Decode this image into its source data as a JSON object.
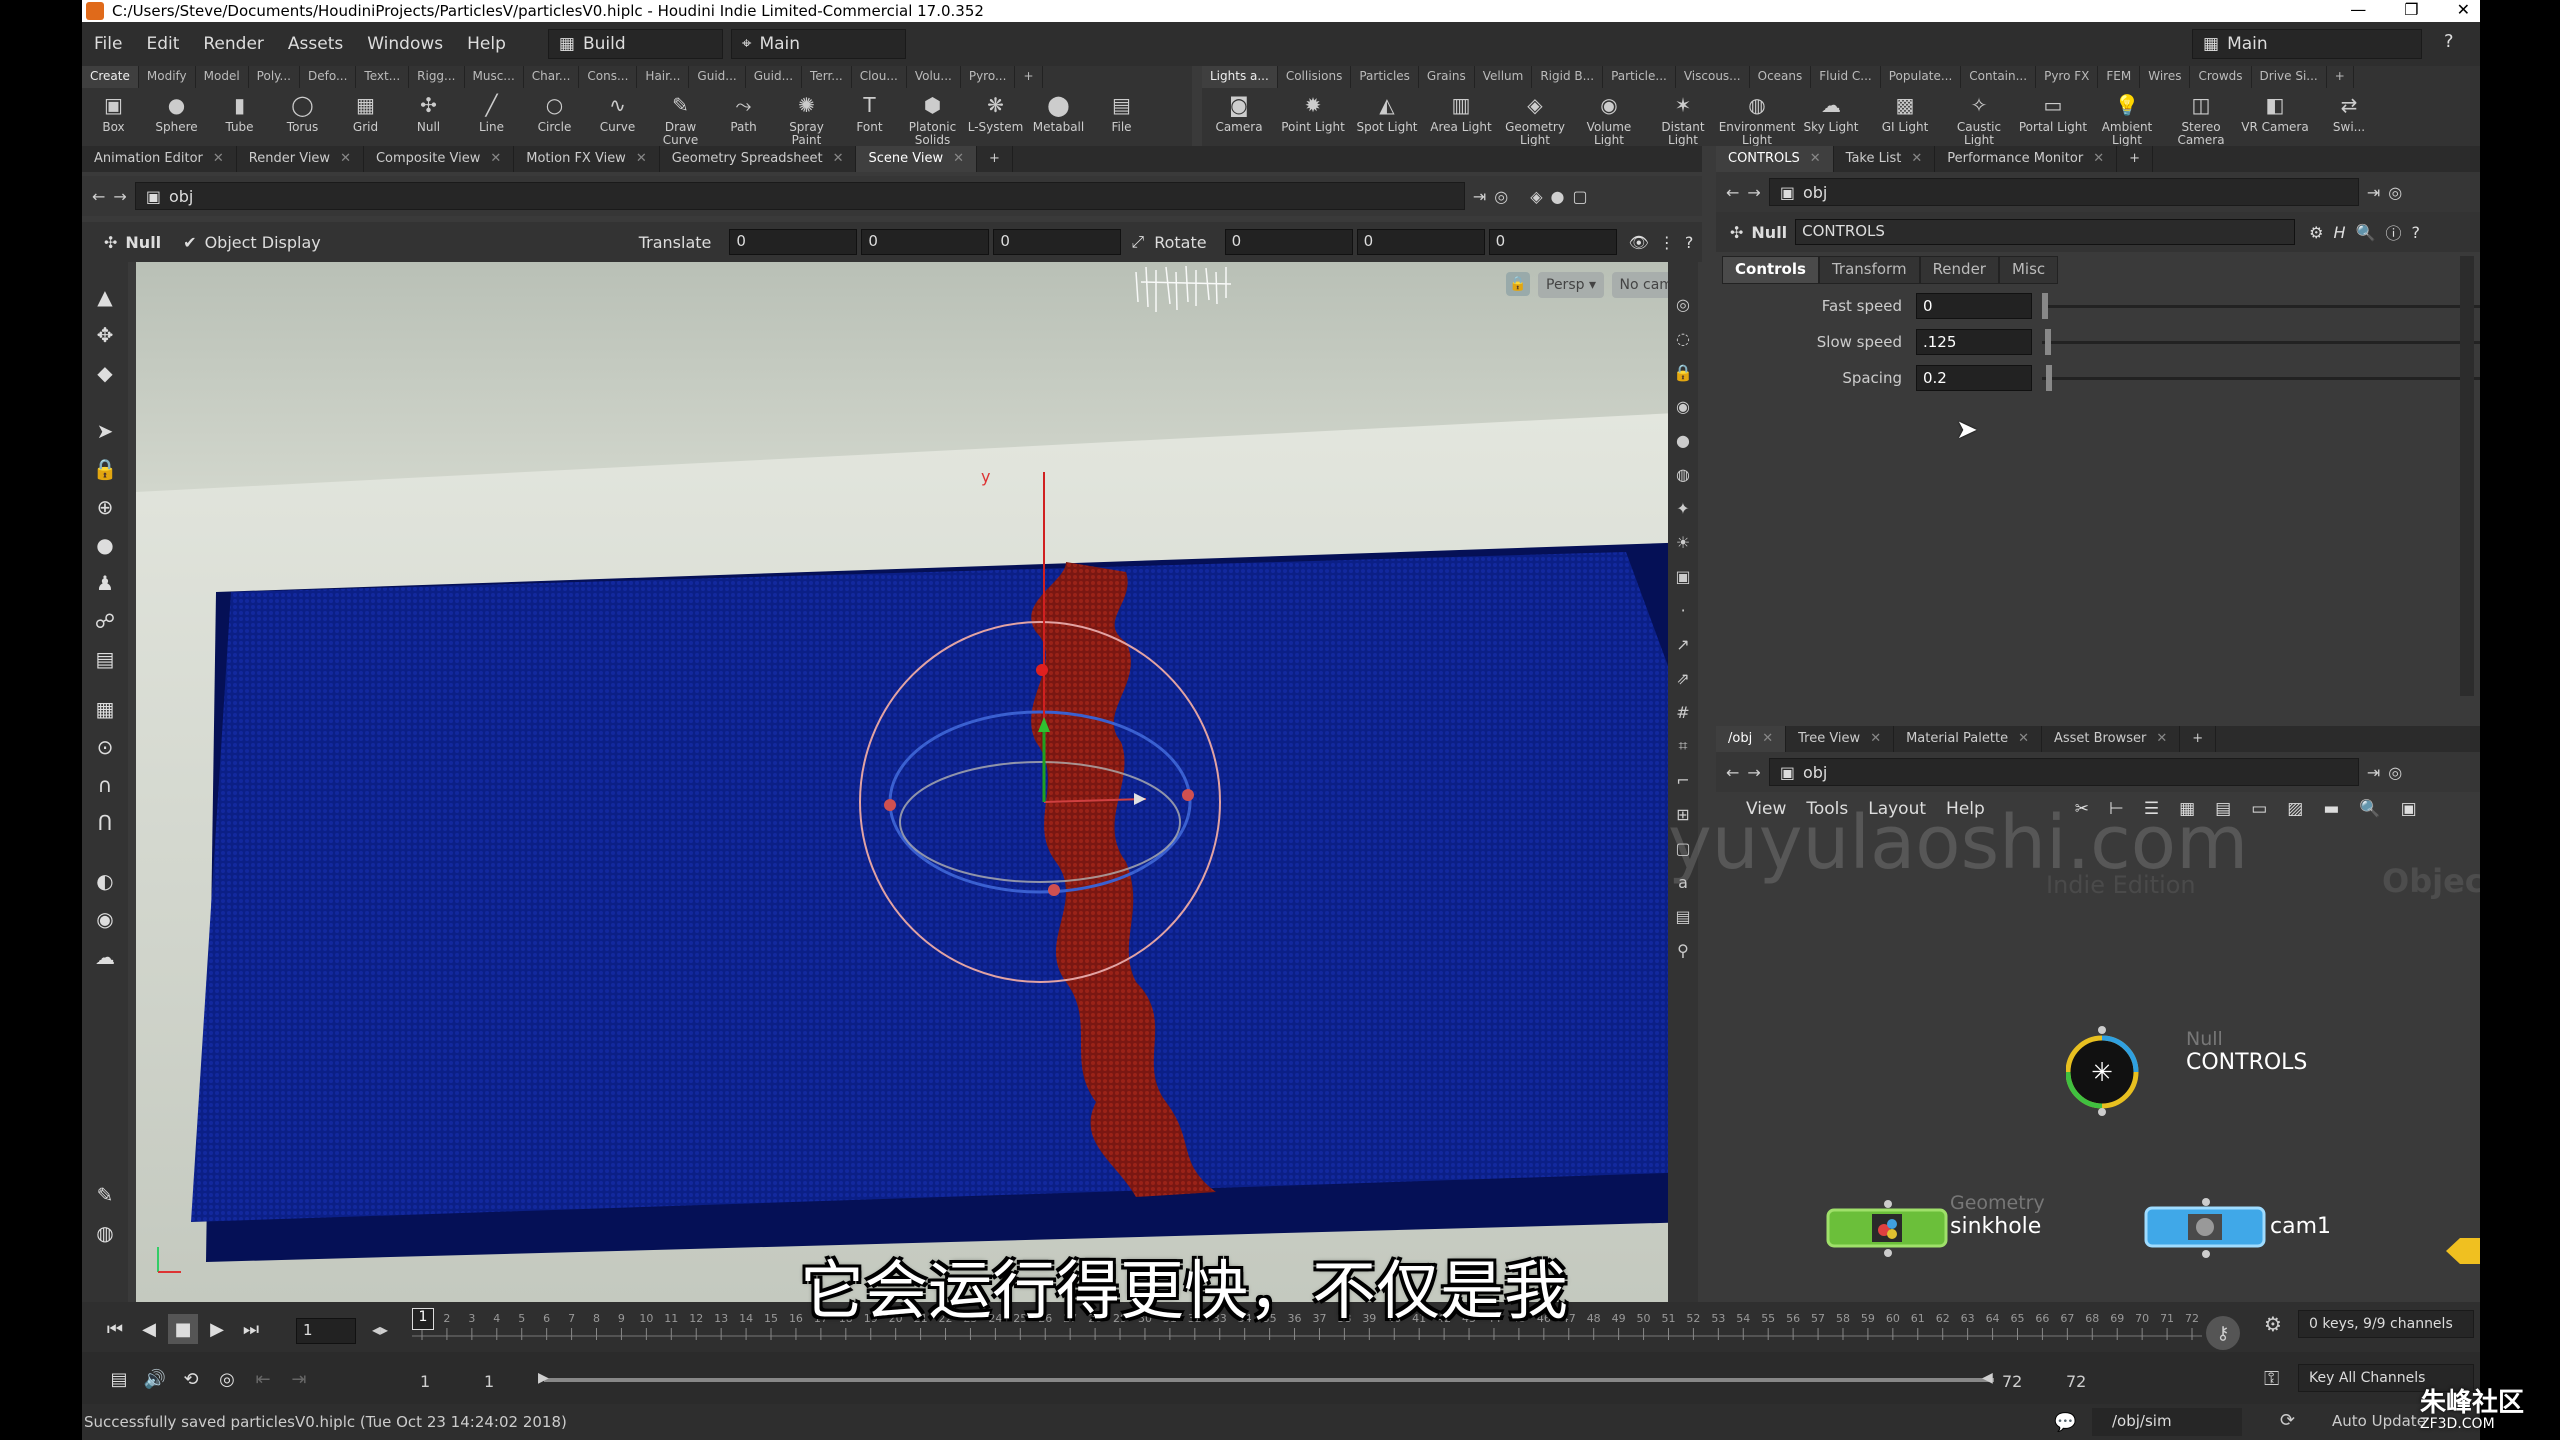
{
  "window": {
    "title": "C:/Users/Steve/Documents/HoudiniProjects/ParticlesV/particlesV0.hiplc - Houdini Indie Limited-Commercial 17.0.352",
    "controls": [
      "—",
      "❐",
      "✕"
    ]
  },
  "menu": {
    "items": [
      "File",
      "Edit",
      "Render",
      "Assets",
      "Windows",
      "Help"
    ],
    "desktop": "Build",
    "context": "Main",
    "right_desktop": "Main"
  },
  "shelf_left": {
    "tabs": [
      "Create",
      "Modify",
      "Model",
      "Poly...",
      "Defo...",
      "Text...",
      "Rigg...",
      "Musc...",
      "Char...",
      "Cons...",
      "Hair...",
      "Guid...",
      "Guid...",
      "Terr...",
      "Clou...",
      "Volu...",
      "Pyro..."
    ],
    "tools": [
      {
        "label": "Box",
        "icon": "box-icon"
      },
      {
        "label": "Sphere",
        "icon": "sphere-icon"
      },
      {
        "label": "Tube",
        "icon": "tube-icon"
      },
      {
        "label": "Torus",
        "icon": "torus-icon"
      },
      {
        "label": "Grid",
        "icon": "grid-icon"
      },
      {
        "label": "Null",
        "icon": "null-icon"
      },
      {
        "label": "Line",
        "icon": "line-icon"
      },
      {
        "label": "Circle",
        "icon": "circle-icon"
      },
      {
        "label": "Curve",
        "icon": "curve-icon"
      },
      {
        "label": "Draw Curve",
        "icon": "draw-curve-icon"
      },
      {
        "label": "Path",
        "icon": "path-icon"
      },
      {
        "label": "Spray Paint",
        "icon": "spray-paint-icon"
      },
      {
        "label": "Font",
        "icon": "font-icon"
      },
      {
        "label": "Platonic Solids",
        "icon": "platonic-icon"
      },
      {
        "label": "L-System",
        "icon": "lsystem-icon"
      },
      {
        "label": "Metaball",
        "icon": "metaball-icon"
      },
      {
        "label": "File",
        "icon": "file-icon"
      }
    ]
  },
  "shelf_right": {
    "tabs": [
      "Lights a...",
      "Collisions",
      "Particles",
      "Grains",
      "Vellum",
      "Rigid B...",
      "Particle...",
      "Viscous...",
      "Oceans",
      "Fluid C...",
      "Populate...",
      "Contain...",
      "Pyro FX",
      "FEM",
      "Wires",
      "Crowds",
      "Drive Si..."
    ],
    "tools": [
      {
        "label": "Camera",
        "icon": "camera-icon"
      },
      {
        "label": "Point Light",
        "icon": "point-light-icon"
      },
      {
        "label": "Spot Light",
        "icon": "spot-light-icon"
      },
      {
        "label": "Area Light",
        "icon": "area-light-icon"
      },
      {
        "label": "Geometry Light",
        "icon": "geometry-light-icon"
      },
      {
        "label": "Volume Light",
        "icon": "volume-light-icon"
      },
      {
        "label": "Distant Light",
        "icon": "distant-light-icon"
      },
      {
        "label": "Environment Light",
        "icon": "environment-light-icon"
      },
      {
        "label": "Sky Light",
        "icon": "sky-light-icon"
      },
      {
        "label": "GI Light",
        "icon": "gi-light-icon"
      },
      {
        "label": "Caustic Light",
        "icon": "caustic-light-icon"
      },
      {
        "label": "Portal Light",
        "icon": "portal-light-icon"
      },
      {
        "label": "Ambient Light",
        "icon": "ambient-light-icon"
      },
      {
        "label": "Stereo Camera",
        "icon": "stereo-camera-icon"
      },
      {
        "label": "VR Camera",
        "icon": "vr-camera-icon"
      },
      {
        "label": "Swi...",
        "icon": "switcher-icon"
      }
    ]
  },
  "left_pane": {
    "tabs": [
      "Animation Editor",
      "Render View",
      "Composite View",
      "Motion FX View",
      "Geometry Spreadsheet",
      "Scene View"
    ],
    "active_tab": "Scene View",
    "path": "obj",
    "op_type": "Null",
    "object_display": "Object Display",
    "translate_label": "Translate",
    "translate": [
      "0",
      "0",
      "0"
    ],
    "rotate_label": "Rotate",
    "rotate": [
      "0",
      "0",
      "0"
    ],
    "viewport": {
      "persp": "Persp ▾",
      "cam": "No cam ▾",
      "axis_y": "y"
    }
  },
  "params_pane": {
    "tabs": [
      "CONTROLS",
      "Take List",
      "Performance Monitor"
    ],
    "path": "obj",
    "node_type": "Null",
    "node_name": "CONTROLS",
    "param_tabs": [
      "Controls",
      "Transform",
      "Render",
      "Misc"
    ],
    "params": [
      {
        "label": "Fast speed",
        "value": "0",
        "level": 0.0
      },
      {
        "label": "Slow speed",
        "value": ".125",
        "level": 0.006
      },
      {
        "label": "Spacing",
        "value": "0.2",
        "level": 0.01
      }
    ]
  },
  "network_pane": {
    "tabs": [
      "/obj",
      "Tree View",
      "Material Palette",
      "Asset Browser"
    ],
    "path": "obj",
    "menu": [
      "View",
      "Tools",
      "Layout",
      "Help"
    ],
    "watermark_edition": "Indie Edition",
    "context_label": "Objects",
    "nodes": [
      {
        "type": "Null",
        "name": "CONTROLS"
      },
      {
        "type": "Geometry",
        "name": "sinkhole"
      },
      {
        "type": "",
        "name": "cam1"
      }
    ]
  },
  "timeline": {
    "current_frame": "1",
    "frame_ticks": [
      "1",
      "2",
      "3",
      "4",
      "5",
      "6",
      "7",
      "8",
      "9",
      "10",
      "11",
      "12",
      "13",
      "14",
      "15",
      "16",
      "17",
      "18",
      "19",
      "20",
      "21",
      "22",
      "23",
      "24",
      "25",
      "26",
      "27",
      "28",
      "29",
      "30",
      "31",
      "32",
      "33",
      "34",
      "35",
      "36",
      "37",
      "38",
      "39",
      "40",
      "41",
      "42",
      "43",
      "44",
      "45",
      "46",
      "47",
      "48",
      "49",
      "50",
      "51",
      "52",
      "53",
      "54",
      "55",
      "56",
      "57",
      "58",
      "59",
      "60",
      "61",
      "62",
      "63",
      "64",
      "65",
      "66",
      "67",
      "68",
      "69",
      "70",
      "71",
      "72"
    ],
    "range_start": "1",
    "range_start2": "1",
    "range_end": "72",
    "range_end2": "72",
    "keys_info": "0 keys, 9/9 channels",
    "key_all": "Key All Channels"
  },
  "status": {
    "message": "Successfully saved particlesV0.hiplc (Tue Oct 23 14:24:02 2018)",
    "sim_path": "/obj/sim",
    "auto_update": "Auto Update"
  },
  "subtitle": "它会运行得更快，不仅是我",
  "watermark": "yuyulaoshi.com",
  "corner_logo": "朱峰社区",
  "corner_logo_sub": "ZF3D.COM",
  "colors": {
    "bg": "#3a3a3a",
    "floor_top": "#d8ddd2",
    "particles_blue": "#0a1f8a",
    "particles_red": "#8a1a14"
  }
}
